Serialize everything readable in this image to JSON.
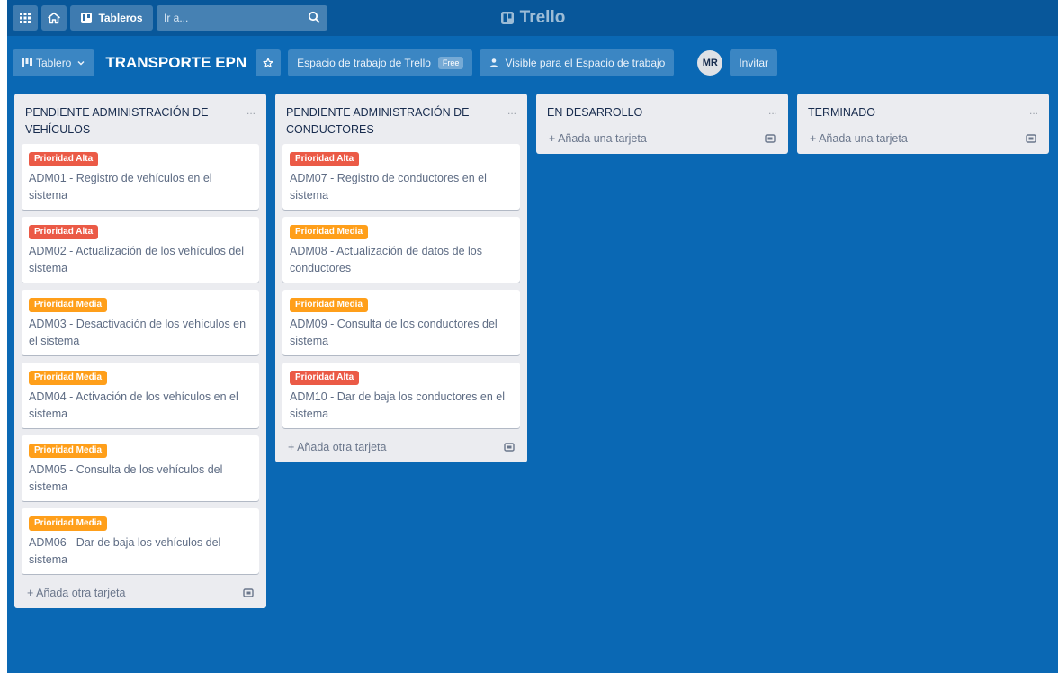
{
  "topbar": {
    "boards_label": "Tableros",
    "search_placeholder": "Ir a...",
    "logo_text": "Trello"
  },
  "board_header": {
    "view_label": "Tablero",
    "board_title": "TRANSPORTE EPN",
    "workspace_label": "Espacio de trabajo de Trello",
    "workspace_badge": "Free",
    "visibility_label": "Visible para el Espacio de trabajo",
    "avatar_initials": "MR",
    "invite_label": "Invitar"
  },
  "label_colors": {
    "Prioridad Alta": "#eb5a46",
    "Prioridad Media": "#ff9f1a"
  },
  "lists": [
    {
      "title": "PENDIENTE ADMINISTRACIÓN DE VEHÍCULOS",
      "menu": "...",
      "add_label": "Añada otra tarjeta",
      "cards": [
        {
          "label": "Prioridad Alta",
          "label_color": "#eb5a46",
          "title": "ADM01 - Registro de vehículos en el sistema"
        },
        {
          "label": "Prioridad Alta",
          "label_color": "#eb5a46",
          "title": "ADM02 - Actualización de los vehículos del sistema"
        },
        {
          "label": "Prioridad Media",
          "label_color": "#ff9f1a",
          "title": "ADM03 - Desactivación de los vehículos en el sistema"
        },
        {
          "label": "Prioridad Media",
          "label_color": "#ff9f1a",
          "title": "ADM04 - Activación de los vehículos en el sistema"
        },
        {
          "label": "Prioridad Media",
          "label_color": "#ff9f1a",
          "title": "ADM05 - Consulta de los vehículos del sistema"
        },
        {
          "label": "Prioridad Media",
          "label_color": "#ff9f1a",
          "title": "ADM06 - Dar de baja los vehículos del sistema"
        }
      ]
    },
    {
      "title": "PENDIENTE ADMINISTRACIÓN DE CONDUCTORES",
      "menu": "...",
      "add_label": "Añada otra tarjeta",
      "cards": [
        {
          "label": "Prioridad Alta",
          "label_color": "#eb5a46",
          "title": "ADM07 - Registro de conductores en el sistema"
        },
        {
          "label": "Prioridad Media",
          "label_color": "#ff9f1a",
          "title": "ADM08 - Actualización de datos de los conductores"
        },
        {
          "label": "Prioridad Media",
          "label_color": "#ff9f1a",
          "title": "ADM09 - Consulta de los conductores del sistema"
        },
        {
          "label": "Prioridad Alta",
          "label_color": "#eb5a46",
          "title": "ADM10 - Dar de baja los conductores en el sistema"
        }
      ]
    },
    {
      "title": "EN DESARROLLO",
      "menu": "...",
      "add_label": "Añada una tarjeta",
      "cards": []
    },
    {
      "title": "TERMINADO",
      "menu": "...",
      "add_label": "Añada una tarjeta",
      "cards": []
    }
  ]
}
